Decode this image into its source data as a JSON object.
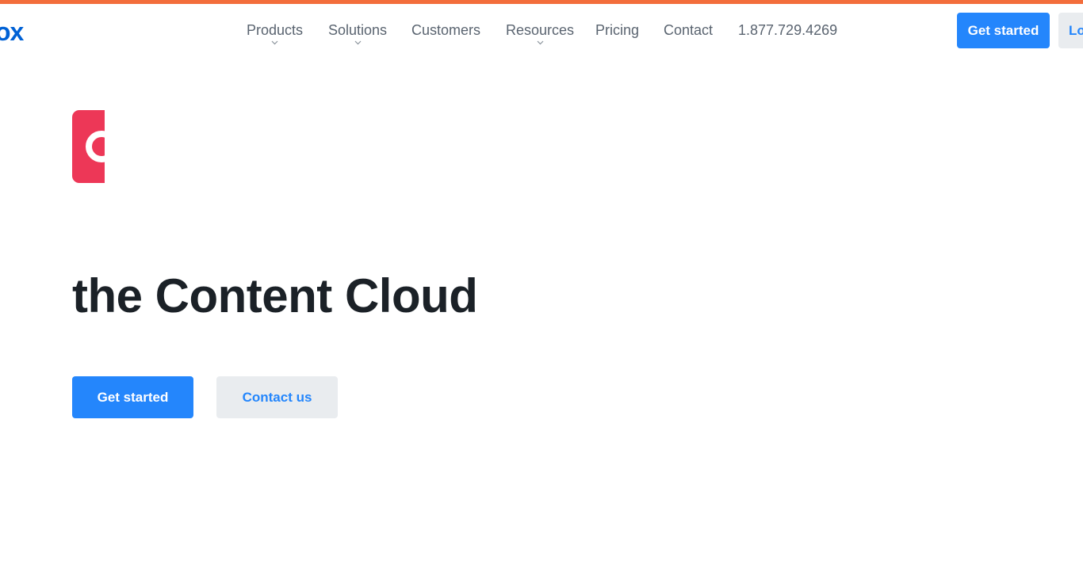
{
  "colors": {
    "accent_top_bar": "#f36d3b",
    "brand_blue": "#0061d5",
    "button_blue": "#2486fc",
    "icon_red": "#ed3757"
  },
  "header": {
    "logo_text": "ox",
    "nav": [
      {
        "label": "Products",
        "has_dropdown": true
      },
      {
        "label": "Solutions",
        "has_dropdown": true
      },
      {
        "label": "Customers",
        "has_dropdown": false
      },
      {
        "label": "Resources",
        "has_dropdown": true
      },
      {
        "label": "Pricing",
        "has_dropdown": false
      },
      {
        "label": "Contact",
        "has_dropdown": false
      }
    ],
    "phone": "1.877.729.4269",
    "get_started_label": "Get started",
    "login_label": "Lo"
  },
  "hero": {
    "icon": "content-cloud-icon",
    "title": "the Content Cloud",
    "primary_button_label": "Get started",
    "secondary_button_label": "Contact us"
  }
}
